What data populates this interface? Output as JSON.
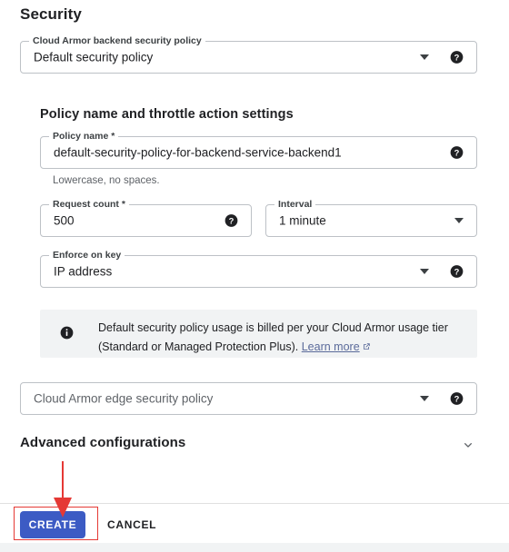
{
  "page": {
    "title": "Security"
  },
  "backend_policy_field": {
    "label": "Cloud Armor backend security policy",
    "value": "Default security policy",
    "caret_icon": "chevron-down-icon",
    "help_icon": "help-circle-icon"
  },
  "throttle_section": {
    "title": "Policy name and throttle action settings",
    "policy_name": {
      "label": "Policy name *",
      "value": "default-security-policy-for-backend-service-backend1",
      "helper_text": "Lowercase, no spaces.",
      "help_icon": "help-circle-icon"
    },
    "request_count": {
      "label": "Request count *",
      "value": "500",
      "help_icon": "help-circle-icon"
    },
    "interval": {
      "label": "Interval",
      "value": "1 minute",
      "caret_icon": "chevron-down-icon"
    },
    "enforce_on_key": {
      "label": "Enforce on key",
      "value": "IP address",
      "caret_icon": "chevron-down-icon",
      "help_icon": "help-circle-icon"
    }
  },
  "info_banner": {
    "icon": "info-circle-icon",
    "text_before_link": "Default security policy usage is billed per your Cloud Armor usage tier (Standard or Managed Protection Plus). ",
    "link_text": "Learn more",
    "link_icon": "open-in-new-icon"
  },
  "edge_policy_field": {
    "placeholder": "Cloud Armor edge security policy",
    "caret_icon": "chevron-down-icon",
    "help_icon": "help-circle-icon"
  },
  "advanced": {
    "label": "Advanced configurations",
    "chevron_icon": "chevron-down-icon"
  },
  "footer": {
    "create_label": "CREATE",
    "cancel_label": "CANCEL"
  },
  "annotations": {
    "highlight_color": "#e53935",
    "arrow_target": "CREATE"
  },
  "colors": {
    "primary_button": "#3c5bc4",
    "link": "#5a6a9a",
    "banner_bg": "#f1f3f4",
    "border": "#bdc1c6",
    "annotation": "#e53935"
  }
}
